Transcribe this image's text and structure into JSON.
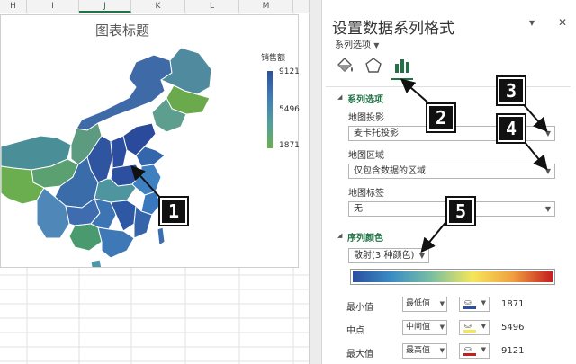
{
  "columns": [
    "H",
    "I",
    "J",
    "K",
    "L",
    "M"
  ],
  "selected_column": "J",
  "chart": {
    "title": "图表标题",
    "legend": {
      "title": "销售额",
      "max": "9121",
      "mid": "5496",
      "min": "1871",
      "colors": [
        "#2b4fa1",
        "#3f7bb8",
        "#4f9f9f",
        "#6ab04d"
      ]
    }
  },
  "callouts": [
    "1",
    "2",
    "3",
    "4",
    "5"
  ],
  "pane": {
    "title": "设置数据系列格式",
    "collapse_icon": "chevron-down-icon",
    "close_icon": "close-icon",
    "series_options_menu": "系列选项",
    "tabs": [
      {
        "name": "fill-line",
        "icon": "paint-bucket-icon"
      },
      {
        "name": "effects",
        "icon": "pentagon-icon"
      },
      {
        "name": "series-options",
        "icon": "bar-chart-icon"
      }
    ],
    "section_series": "系列选项",
    "projection_label": "地图投影",
    "projection_value": "麦卡托投影",
    "area_label": "地图区域",
    "area_value": "仅包含数据的区域",
    "labels_label": "地图标签",
    "labels_value": "无",
    "section_color": "序列颜色",
    "color_scheme_value": "散射(3 种颜色)",
    "gradient_colors": [
      "#2b4fa1",
      "#3b8ec4",
      "#7cc0a0",
      "#f5e65a",
      "#f0a040",
      "#c41e1e"
    ],
    "rows": [
      {
        "label": "最小值",
        "type": "最低值",
        "value": "1871",
        "color": "#2b4fa1"
      },
      {
        "label": "中点",
        "type": "中间值",
        "value": "5496",
        "color": "#f5e65a"
      },
      {
        "label": "最大值",
        "type": "最高值",
        "value": "9121",
        "color": "#c41e1e"
      }
    ]
  }
}
